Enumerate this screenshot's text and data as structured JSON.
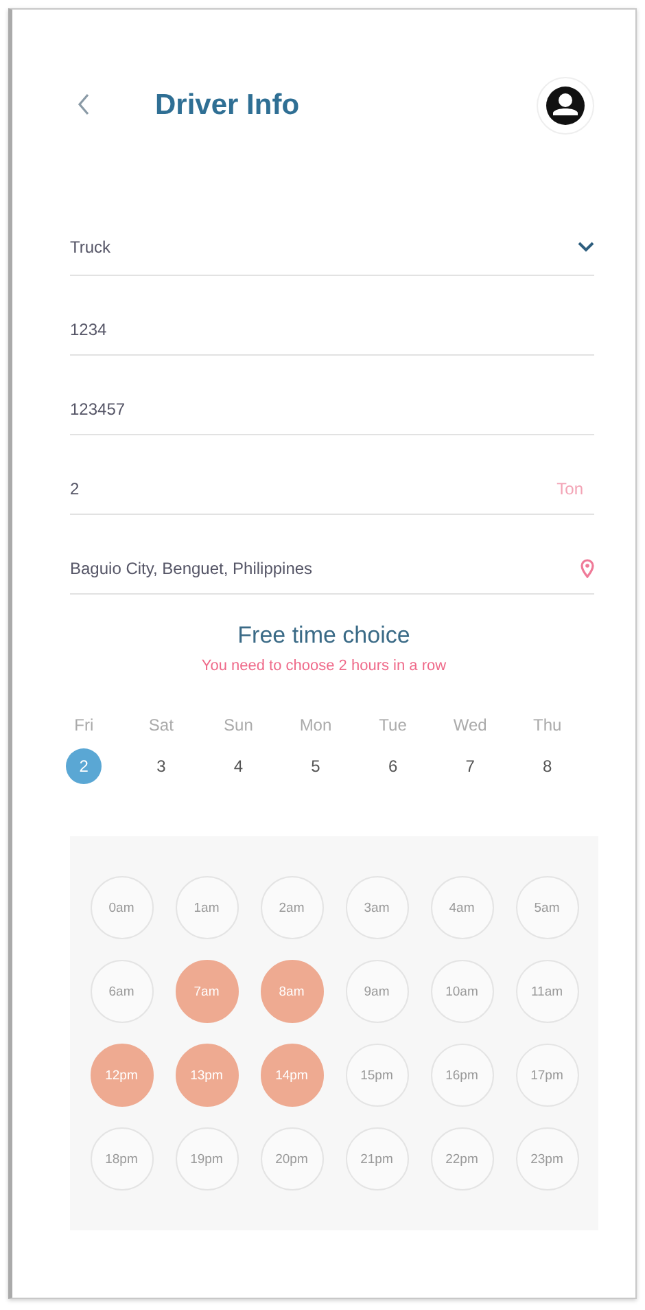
{
  "header": {
    "title": "Driver Info"
  },
  "fields": [
    {
      "kind": "select",
      "value": "Truck"
    },
    {
      "kind": "text",
      "value": "1234"
    },
    {
      "kind": "text",
      "value": "123457"
    },
    {
      "kind": "unit",
      "value": "2",
      "unit": "Ton"
    },
    {
      "kind": "location",
      "value": "Baguio City, Benguet, Philippines"
    }
  ],
  "schedule": {
    "title": "Free time choice",
    "hint": "You need to choose 2 hours in a row",
    "days": [
      {
        "weekday": "Fri",
        "date": "2",
        "selected": true
      },
      {
        "weekday": "Sat",
        "date": "3",
        "selected": false
      },
      {
        "weekday": "Sun",
        "date": "4",
        "selected": false
      },
      {
        "weekday": "Mon",
        "date": "5",
        "selected": false
      },
      {
        "weekday": "Tue",
        "date": "6",
        "selected": false
      },
      {
        "weekday": "Wed",
        "date": "7",
        "selected": false
      },
      {
        "weekday": "Thu",
        "date": "8",
        "selected": false
      }
    ],
    "hours": [
      {
        "label": "0am",
        "selected": false
      },
      {
        "label": "1am",
        "selected": false
      },
      {
        "label": "2am",
        "selected": false
      },
      {
        "label": "3am",
        "selected": false
      },
      {
        "label": "4am",
        "selected": false
      },
      {
        "label": "5am",
        "selected": false
      },
      {
        "label": "6am",
        "selected": false
      },
      {
        "label": "7am",
        "selected": true
      },
      {
        "label": "8am",
        "selected": true
      },
      {
        "label": "9am",
        "selected": false
      },
      {
        "label": "10am",
        "selected": false
      },
      {
        "label": "11am",
        "selected": false
      },
      {
        "label": "12pm",
        "selected": true
      },
      {
        "label": "13pm",
        "selected": true
      },
      {
        "label": "14pm",
        "selected": true
      },
      {
        "label": "15pm",
        "selected": false
      },
      {
        "label": "16pm",
        "selected": false
      },
      {
        "label": "17pm",
        "selected": false
      },
      {
        "label": "18pm",
        "selected": false
      },
      {
        "label": "19pm",
        "selected": false
      },
      {
        "label": "20pm",
        "selected": false
      },
      {
        "label": "21pm",
        "selected": false
      },
      {
        "label": "22pm",
        "selected": false
      },
      {
        "label": "23pm",
        "selected": false
      }
    ]
  }
}
